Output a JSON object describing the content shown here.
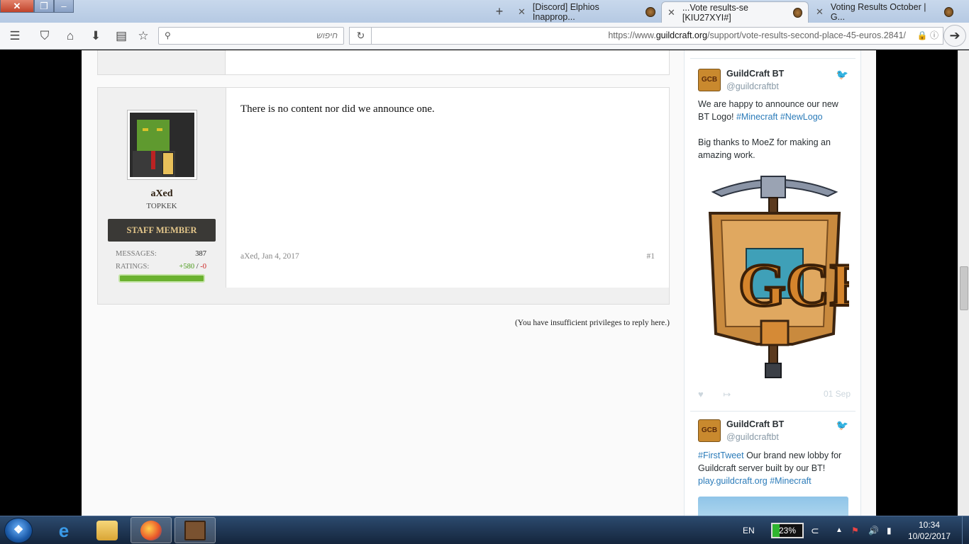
{
  "browser": {
    "tabs": [
      {
        "label": "[Discord] Elphios Inapprop..."
      },
      {
        "label": "...Vote results-se [KIU27XYI#]",
        "active": true
      },
      {
        "label": "Voting Results October | G..."
      }
    ],
    "search_placeholder": "חיפוש",
    "url_prefix": "https://www.",
    "url_domain": "guildcraft.org",
    "url_path": "/support/vote-results-second-place-45-euros.2841/"
  },
  "post": {
    "username": "aXed",
    "user_title": "TOPKEK",
    "badge": "STAFF MEMBER",
    "messages_label": "MESSAGES:",
    "messages_value": "387",
    "ratings_label": "RATINGS:",
    "ratings_pos": "+580",
    "ratings_sep": " / ",
    "ratings_neg": "-0",
    "message": "There is no content nor did we announce one.",
    "meta": "aXed, Jan 4, 2017",
    "number": "#1"
  },
  "no_reply_notice": "(You have insufficient privileges to reply here.)",
  "twitter": {
    "tweets": [
      {
        "name": "GuildCraft BT",
        "handle": "@guildcraftbt",
        "text_1": "We are happy to announce our new BT Logo! ",
        "tag_1": "#Minecraft",
        "tag_2": "#NewLogo",
        "text_2": "Big thanks to MoeZ for making an amazing work.",
        "date": "01 Sep"
      },
      {
        "name": "GuildCraft BT",
        "handle": "@guildcraftbt",
        "tag_1": "#FirstTweet",
        "text_1": " Our brand new lobby for Guildcraft server built by our BT!",
        "link": "play.guildcraft.org",
        "tag_2": "#Minecraft"
      }
    ],
    "logo_text": "GCB"
  },
  "taskbar": {
    "lang": "EN",
    "battery": "23%",
    "battery_level": 0.23,
    "time": "10:34",
    "date": "10/02/2017"
  }
}
